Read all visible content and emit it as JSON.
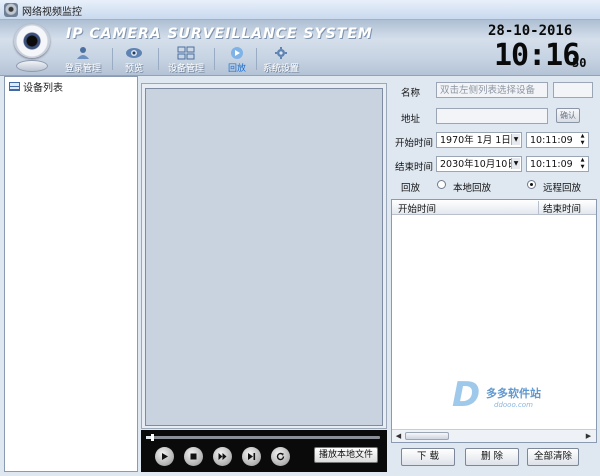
{
  "window": {
    "title": "网络视频监控"
  },
  "header": {
    "brand": "IP CAMERA SURVEILLANCE SYSTEM",
    "date": "28-10-2016",
    "time": "10:16",
    "seconds": "50",
    "nav": [
      {
        "label": "登录管理",
        "icon": "user-icon"
      },
      {
        "label": "预览",
        "icon": "camera-eye-icon"
      },
      {
        "label": "设备管理",
        "icon": "devices-icon"
      },
      {
        "label": "回放",
        "icon": "playback-icon",
        "active": true
      },
      {
        "label": "系统设置",
        "icon": "gear-icon"
      }
    ]
  },
  "tree": {
    "root_label": "设备列表"
  },
  "playback_form": {
    "name_label": "名称",
    "name_placeholder": "双击左侧列表选择设备",
    "address_label": "地址",
    "address_value": "",
    "confirm_label": "确认",
    "start_label": "开始时间",
    "start_date": "1970年 1月 1日",
    "start_time": "10:11:09",
    "end_label": "结束时间",
    "end_date": "2030年10月10日",
    "end_time": "10:11:09",
    "mode_label": "回放",
    "local_label": "本地回放",
    "remote_label": "远程回放",
    "selected_mode": "remote"
  },
  "results_table": {
    "columns": [
      "开始时间",
      "结束时间"
    ],
    "rows": []
  },
  "player": {
    "play_local_label": "播放本地文件",
    "progress": 0.02
  },
  "buttons": {
    "download": "下  载",
    "delete": "删  除",
    "clear_all": "全部清除"
  },
  "watermark": {
    "text": "多多软件站",
    "sub": "ddooo.com"
  }
}
